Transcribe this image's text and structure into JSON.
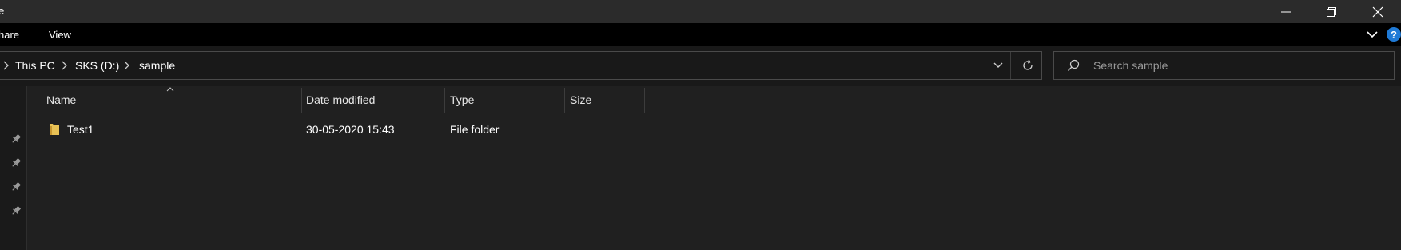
{
  "window": {
    "title": "e",
    "minimize_glyph": "—",
    "restore_glyph": "❐",
    "close_glyph": "✕"
  },
  "ribbon": {
    "tabs": [
      "hare",
      "View"
    ]
  },
  "address": {
    "crumbs": [
      "This PC",
      "SKS (D:)",
      "sample"
    ]
  },
  "search": {
    "placeholder": "Search sample"
  },
  "columns": {
    "name": "Name",
    "date_modified": "Date modified",
    "type": "Type",
    "size": "Size"
  },
  "files": [
    {
      "name": "Test1",
      "date_modified": "30-05-2020 15:43",
      "type": "File folder",
      "size": "",
      "icon": "folder-icon"
    }
  ],
  "colors": {
    "accent_help": "#1f7ad6",
    "folder": "#e8c155"
  }
}
